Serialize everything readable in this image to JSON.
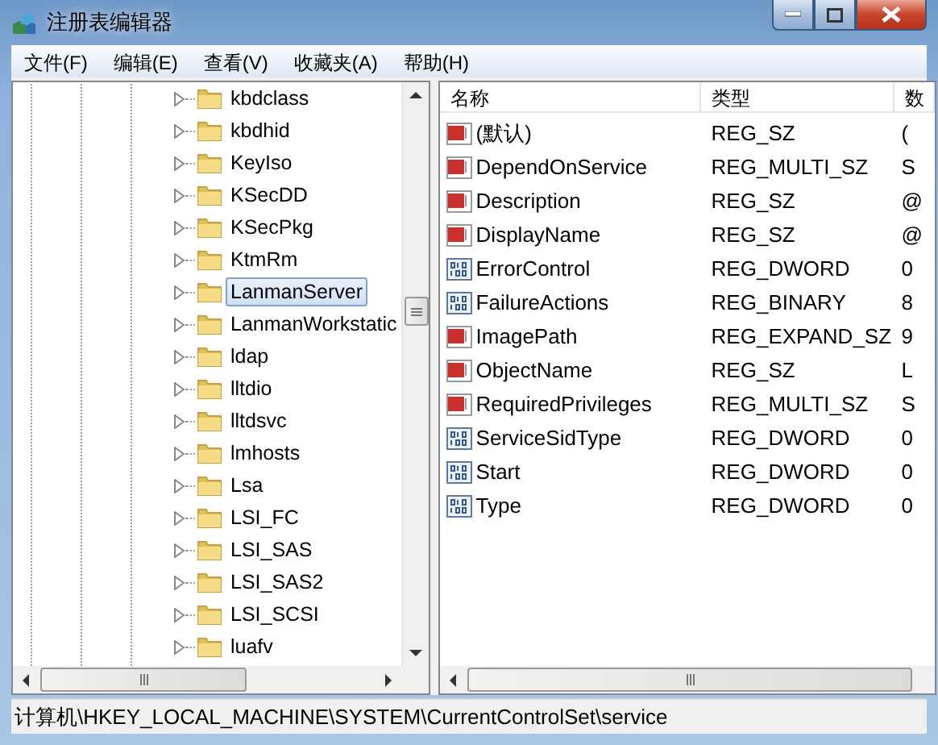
{
  "window": {
    "title": "注册表编辑器"
  },
  "menu": [
    "文件(F)",
    "编辑(E)",
    "查看(V)",
    "收藏夹(A)",
    "帮助(H)"
  ],
  "tree": {
    "items": [
      {
        "label": "kbdclass",
        "selected": false
      },
      {
        "label": "kbdhid",
        "selected": false
      },
      {
        "label": "KeyIso",
        "selected": false
      },
      {
        "label": "KSecDD",
        "selected": false
      },
      {
        "label": "KSecPkg",
        "selected": false
      },
      {
        "label": "KtmRm",
        "selected": false
      },
      {
        "label": "LanmanServer",
        "selected": true
      },
      {
        "label": "LanmanWorkstatic",
        "selected": false
      },
      {
        "label": "ldap",
        "selected": false
      },
      {
        "label": "lltdio",
        "selected": false
      },
      {
        "label": "lltdsvc",
        "selected": false
      },
      {
        "label": "lmhosts",
        "selected": false
      },
      {
        "label": "Lsa",
        "selected": false
      },
      {
        "label": "LSI_FC",
        "selected": false
      },
      {
        "label": "LSI_SAS",
        "selected": false
      },
      {
        "label": "LSI_SAS2",
        "selected": false
      },
      {
        "label": "LSI_SCSI",
        "selected": false
      },
      {
        "label": "luafv",
        "selected": false
      }
    ]
  },
  "table": {
    "columns": [
      "名称",
      "类型",
      "数"
    ],
    "rows": [
      {
        "kind": "string",
        "name": "(默认)",
        "type": "REG_SZ",
        "column_3": "("
      },
      {
        "kind": "string",
        "name": "DependOnService",
        "type": "REG_MULTI_SZ",
        "column_3": "S"
      },
      {
        "kind": "string",
        "name": "Description",
        "type": "REG_SZ",
        "column_3": "@"
      },
      {
        "kind": "string",
        "name": "DisplayName",
        "type": "REG_SZ",
        "column_3": "@"
      },
      {
        "kind": "binary",
        "name": "ErrorControl",
        "type": "REG_DWORD",
        "column_3": "0"
      },
      {
        "kind": "binary",
        "name": "FailureActions",
        "type": "REG_BINARY",
        "column_3": "8"
      },
      {
        "kind": "string",
        "name": "ImagePath",
        "type": "REG_EXPAND_SZ",
        "column_3": "9"
      },
      {
        "kind": "string",
        "name": "ObjectName",
        "type": "REG_SZ",
        "column_3": "L"
      },
      {
        "kind": "string",
        "name": "RequiredPrivileges",
        "type": "REG_MULTI_SZ",
        "column_3": "S"
      },
      {
        "kind": "binary",
        "name": "ServiceSidType",
        "type": "REG_DWORD",
        "column_3": "0"
      },
      {
        "kind": "binary",
        "name": "Start",
        "type": "REG_DWORD",
        "column_3": "0"
      },
      {
        "kind": "binary",
        "name": "Type",
        "type": "REG_DWORD",
        "column_3": "0"
      }
    ]
  },
  "status_bar": "计算机\\HKEY_LOCAL_MACHINE\\SYSTEM\\CurrentControlSet\\service"
}
